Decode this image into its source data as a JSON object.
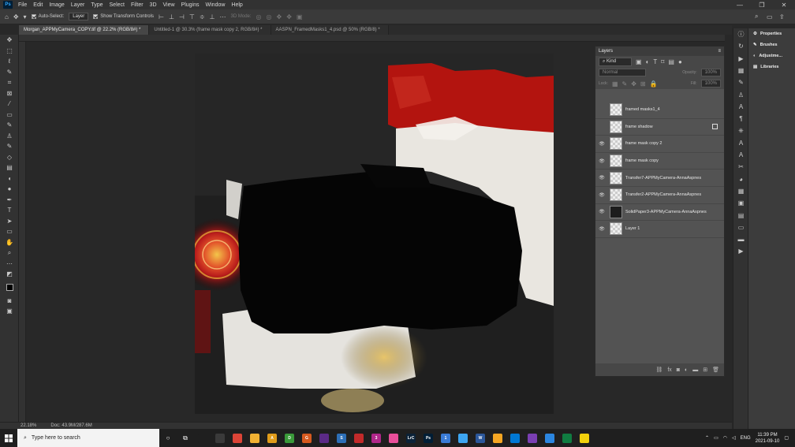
{
  "menu": {
    "logo": "Ps",
    "items": [
      "File",
      "Edit",
      "Image",
      "Layer",
      "Type",
      "Select",
      "Filter",
      "3D",
      "View",
      "Plugins",
      "Window",
      "Help"
    ],
    "window_controls": [
      "—",
      "❐",
      "✕"
    ]
  },
  "options": {
    "auto_select_label": "Auto-Select:",
    "auto_select_value": "Layer",
    "transform_label": "Show Transform Controls",
    "mode3d_label": "3D Mode:"
  },
  "tabs": [
    {
      "label": "Morgan_APPMyCamera_COPY.tif @ 22.2% (RGB/8#) *",
      "active": true
    },
    {
      "label": "Untitled-1 @ 30.3% (frame mask copy 2, RGB/8#) *",
      "active": false
    },
    {
      "label": "AASPN_FramedMasks1_4.psd @ 50% (RGB/8) *",
      "active": false
    }
  ],
  "status": {
    "zoom": "22.18%",
    "doc": "Doc: 43.9M/287.6M"
  },
  "layers_panel": {
    "title": "Layers",
    "kind_label": "Kind",
    "blend_mode": "Normal",
    "opacity_label": "Opacity:",
    "opacity_value": "100%",
    "lock_label": "Lock:",
    "fill_label": "Fill:",
    "fill_value": "100%",
    "layers": [
      {
        "name": "framed masks1_4",
        "visible": false,
        "thumb": "checker",
        "badge": false
      },
      {
        "name": "frame shadow",
        "visible": false,
        "thumb": "checker",
        "badge": true
      },
      {
        "name": "frame mask copy 2",
        "visible": true,
        "thumb": "checker",
        "badge": false
      },
      {
        "name": "frame mask copy",
        "visible": true,
        "thumb": "checker",
        "badge": false
      },
      {
        "name": "Transfer7-APPMyCamera-AnnaAspnes",
        "visible": true,
        "thumb": "checker",
        "badge": false
      },
      {
        "name": "Transfer2-APPMyCamera-AnnaAspnes",
        "visible": true,
        "thumb": "checker",
        "badge": false
      },
      {
        "name": "SolidPaper3-APPMyCamera-AnnaAspnes",
        "visible": true,
        "thumb": "dark",
        "badge": false
      },
      {
        "name": "Layer 1",
        "visible": true,
        "thumb": "checker",
        "badge": false
      }
    ]
  },
  "right_panel": {
    "items": [
      "Properties",
      "Brushes",
      "Adjustme...",
      "Libraries"
    ]
  },
  "taskbar": {
    "search_placeholder": "Type here to search",
    "apps": [
      {
        "label": "",
        "color": "#1f1f1f"
      },
      {
        "label": "",
        "color": "#3a3a3a"
      },
      {
        "label": "",
        "color": "#db4437"
      },
      {
        "label": "",
        "color": "#f2b233"
      },
      {
        "label": "A",
        "color": "#e09c1a"
      },
      {
        "label": "D",
        "color": "#3a9a3a"
      },
      {
        "label": "G",
        "color": "#d65a1f"
      },
      {
        "label": "",
        "color": "#5b2a86"
      },
      {
        "label": "S",
        "color": "#2d6fb7"
      },
      {
        "label": "",
        "color": "#c22a2a"
      },
      {
        "label": "3",
        "color": "#b0278a"
      },
      {
        "label": "",
        "color": "#e94e9a"
      },
      {
        "label": "LrC",
        "color": "#0b2238"
      },
      {
        "label": "Ps",
        "color": "#001e36"
      },
      {
        "label": "1",
        "color": "#3a7bd5"
      },
      {
        "label": "",
        "color": "#3da6f2"
      },
      {
        "label": "W",
        "color": "#2b579a"
      },
      {
        "label": "",
        "color": "#f5a623"
      },
      {
        "label": "",
        "color": "#0078d4"
      },
      {
        "label": "",
        "color": "#7a3fb2"
      },
      {
        "label": "",
        "color": "#2b86e0"
      },
      {
        "label": "",
        "color": "#107c41"
      },
      {
        "label": "",
        "color": "#f2d10c"
      }
    ],
    "lang": "ENG",
    "time": "11:39 PM",
    "date": "2021-09-10"
  }
}
